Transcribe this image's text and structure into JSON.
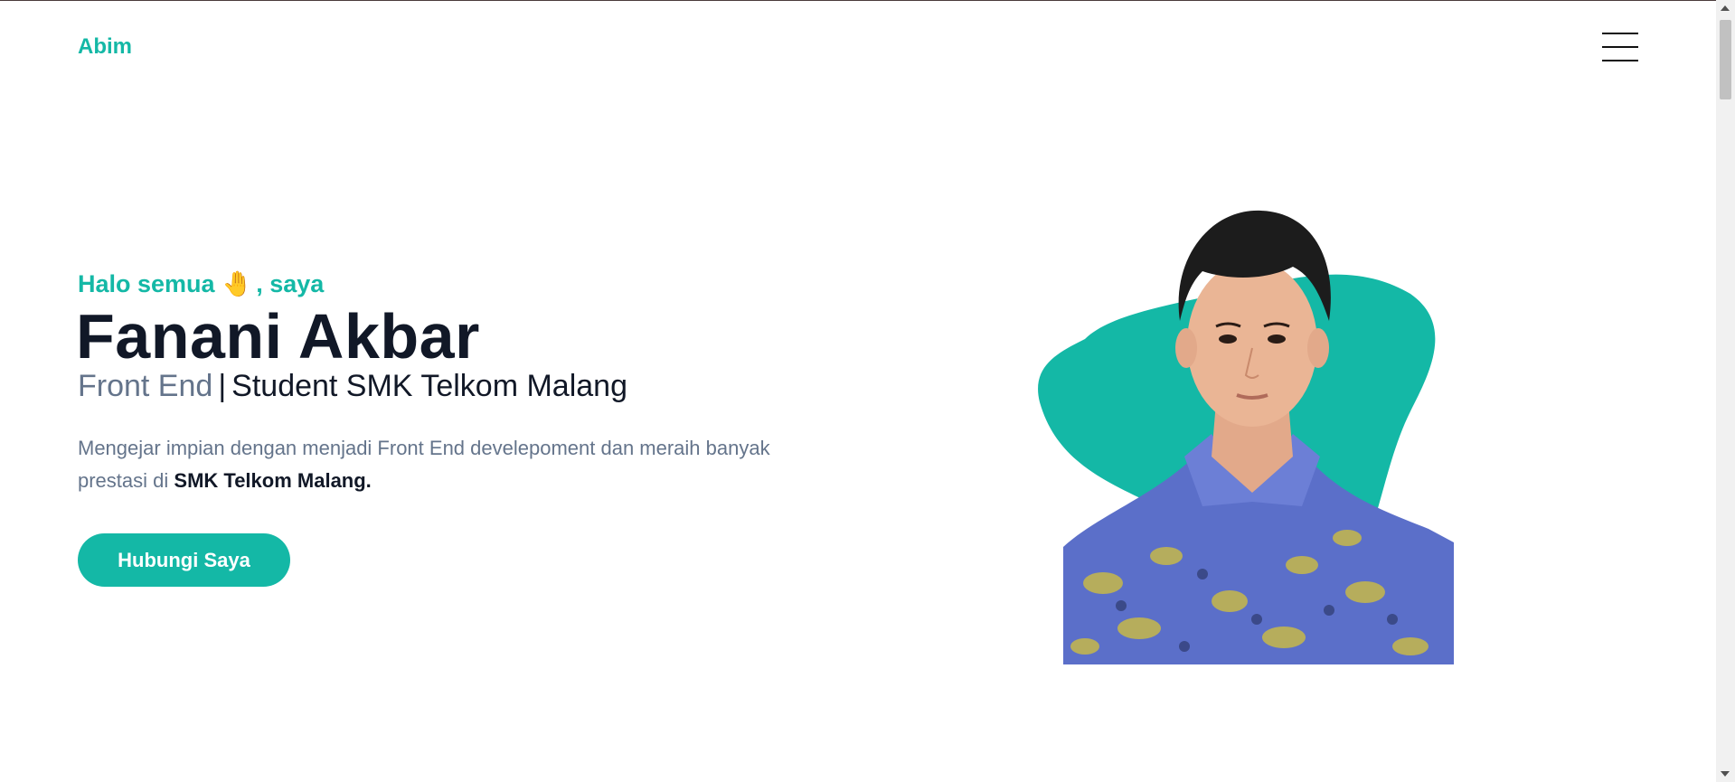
{
  "header": {
    "logo": "Abim",
    "menu_icon": "hamburger-menu-icon"
  },
  "hero": {
    "greeting_prefix": "Halo semua",
    "greeting_emoji": "🤚",
    "greeting_suffix": ", saya",
    "name": "Fanani Akbar",
    "role": "Front End",
    "separator": "|",
    "school_role": "Student SMK Telkom Malang",
    "description": "Mengejar impian dengan menjadi Front End develepoment dan meraih banyak prestasi di ",
    "description_highlight": "SMK Telkom Malang.",
    "cta_label": "Hubungi Saya",
    "image_icon": "profile-photo"
  },
  "colors": {
    "accent": "#14b8a6",
    "heading": "#111827",
    "muted": "#64748b"
  }
}
